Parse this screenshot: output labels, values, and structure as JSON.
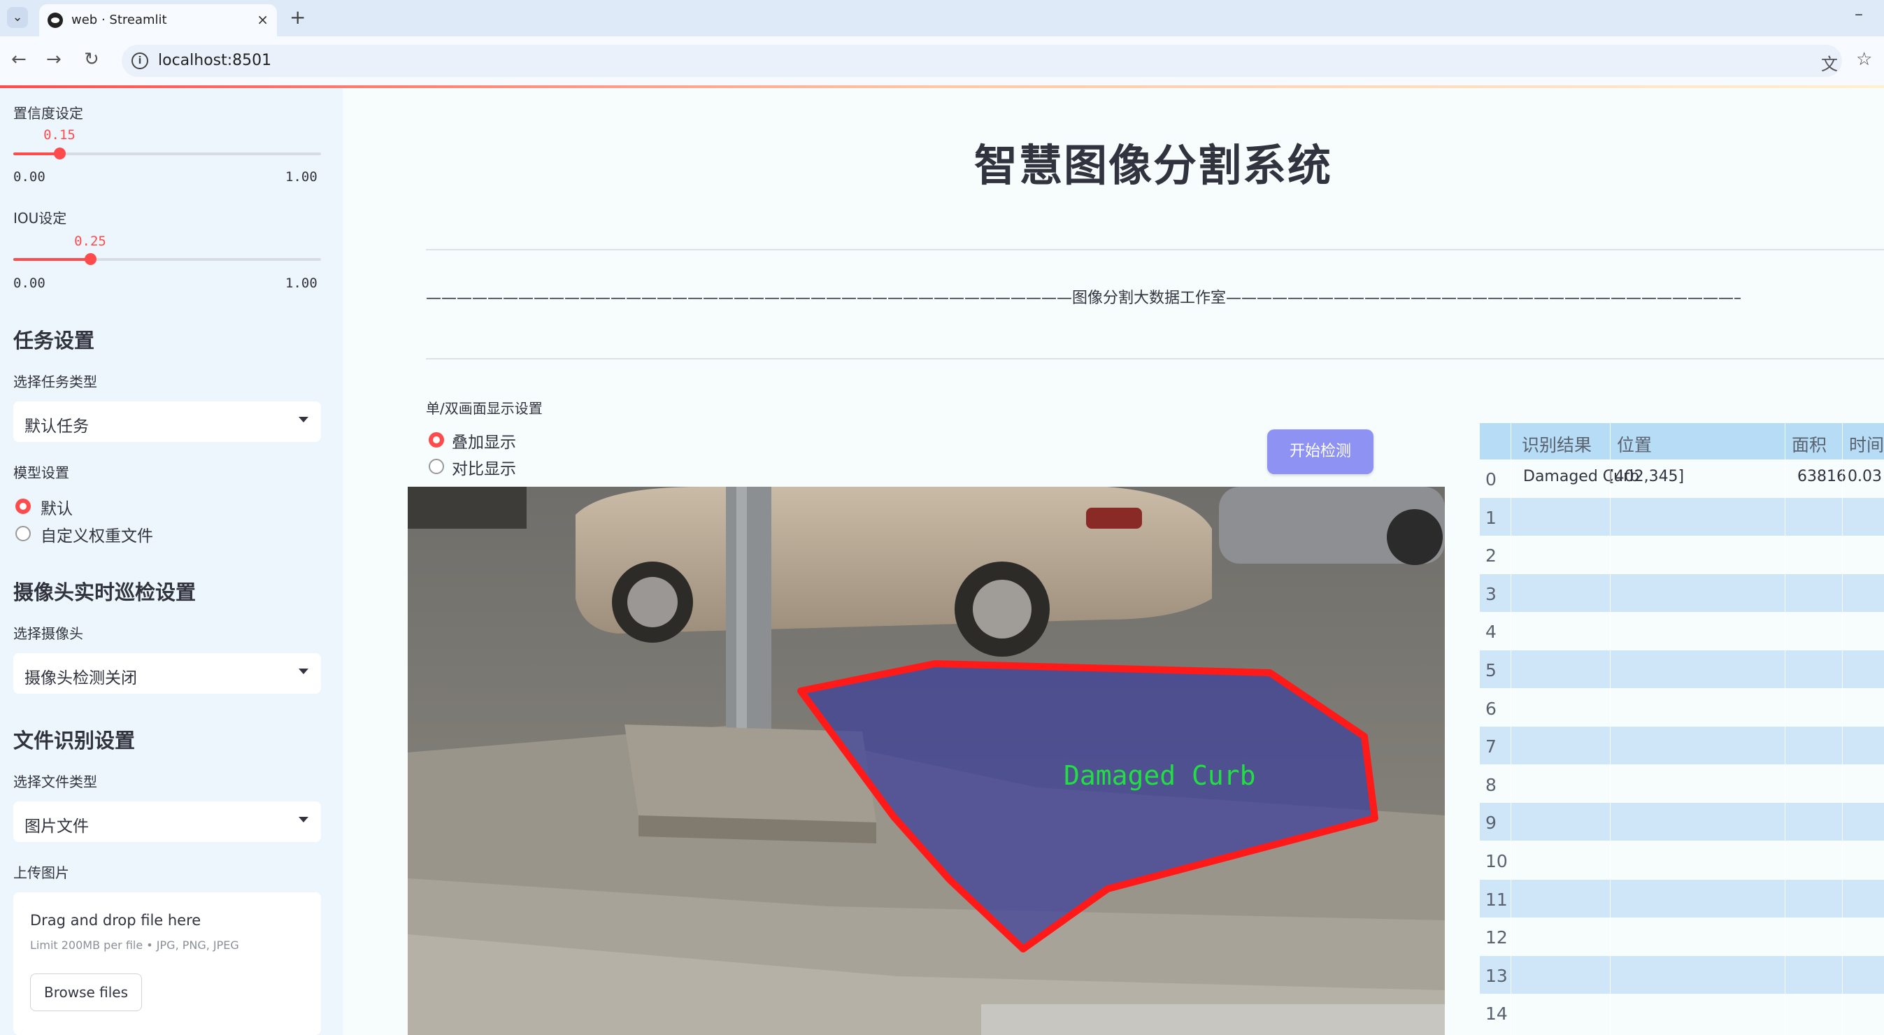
{
  "browser": {
    "tab_title": "web · Streamlit",
    "tab_close": "×",
    "new_tab": "+",
    "minimize": "–",
    "url": "localhost:8501",
    "back": "←",
    "forward": "→",
    "reload": "↻",
    "info": "i",
    "translate": "⽂",
    "bookmark": "☆"
  },
  "sidebar": {
    "confidence": {
      "label": "置信度设定",
      "value": 0.15,
      "value_text": "0.15",
      "min": "0.00",
      "max": "1.00"
    },
    "iou": {
      "label": "IOU设定",
      "value": 0.25,
      "value_text": "0.25",
      "min": "0.00",
      "max": "1.00"
    },
    "task_heading": "任务设置",
    "task_type_label": "选择任务类型",
    "task_type_value": "默认任务",
    "model_label": "模型设置",
    "model_options": [
      "默认",
      "自定义权重文件"
    ],
    "model_selected": 0,
    "camera_heading": "摄像头实时巡检设置",
    "camera_label": "选择摄像头",
    "camera_value": "摄像头检测关闭",
    "file_heading": "文件识别设置",
    "file_type_label": "选择文件类型",
    "file_type_value": "图片文件",
    "upload_label": "上传图片",
    "upload": {
      "title": "Drag and drop file here",
      "subtitle": "Limit 200MB per file • JPG, PNG, JPEG",
      "button": "Browse files"
    }
  },
  "main": {
    "title": "智慧图像分割系统",
    "divider_text": "——————————————————————————————————————————图像分割大数据工作室——————————————————————————————————————————",
    "display_mode_label": "单/双画面显示设置",
    "display_options": [
      "叠加显示",
      "对比显示"
    ],
    "display_selected": 0,
    "start_button": "开始检测",
    "detection_label": "Damaged  Curb",
    "colors": {
      "accent": "#ff4b4b",
      "button": "#8e92f2",
      "table_header": "#b7dcf5",
      "table_stripe": "#cfe6f8",
      "mask_outline": "#ff1a1a",
      "label_green": "#22dd44"
    }
  },
  "table": {
    "headers": [
      "识别结果",
      "位置",
      "面积",
      "时间"
    ],
    "rows": [
      {
        "index": "0",
        "result": "Damaged  Curb",
        "position": "[402,345]",
        "area": "63816",
        "time": "0.03"
      },
      {
        "index": "1"
      },
      {
        "index": "2"
      },
      {
        "index": "3"
      },
      {
        "index": "4"
      },
      {
        "index": "5"
      },
      {
        "index": "6"
      },
      {
        "index": "7"
      },
      {
        "index": "8"
      },
      {
        "index": "9"
      },
      {
        "index": "10"
      },
      {
        "index": "11"
      },
      {
        "index": "12"
      },
      {
        "index": "13"
      },
      {
        "index": "14"
      }
    ]
  }
}
